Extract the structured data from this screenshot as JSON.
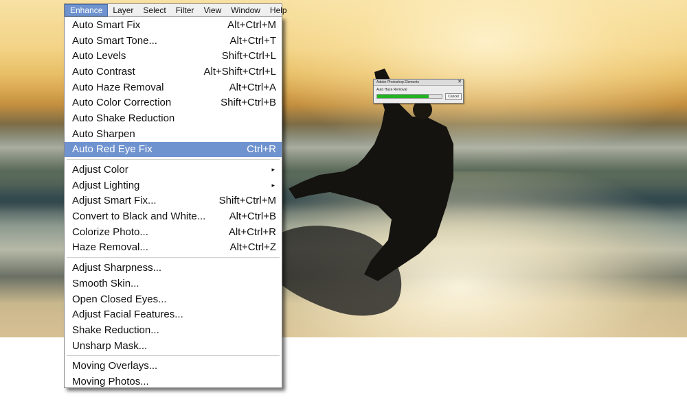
{
  "menubar": {
    "items": [
      "Enhance",
      "Layer",
      "Select",
      "Filter",
      "View",
      "Window",
      "Help"
    ],
    "active": "Enhance"
  },
  "enhance_menu": {
    "group1": [
      {
        "label": "Auto Smart Fix",
        "shortcut": "Alt+Ctrl+M"
      },
      {
        "label": "Auto Smart Tone...",
        "shortcut": "Alt+Ctrl+T"
      },
      {
        "label": "Auto Levels",
        "shortcut": "Shift+Ctrl+L"
      },
      {
        "label": "Auto Contrast",
        "shortcut": "Alt+Shift+Ctrl+L"
      },
      {
        "label": "Auto Haze Removal",
        "shortcut": "Alt+Ctrl+A"
      },
      {
        "label": "Auto Color Correction",
        "shortcut": "Shift+Ctrl+B"
      },
      {
        "label": "Auto Shake Reduction",
        "shortcut": ""
      },
      {
        "label": "Auto Sharpen",
        "shortcut": ""
      },
      {
        "label": "Auto Red Eye Fix",
        "shortcut": "Ctrl+R",
        "highlighted": true
      }
    ],
    "group2": [
      {
        "label": "Adjust Color",
        "submenu": true
      },
      {
        "label": "Adjust Lighting",
        "submenu": true
      },
      {
        "label": "Adjust Smart Fix...",
        "shortcut": "Shift+Ctrl+M"
      },
      {
        "label": "Convert to Black and White...",
        "shortcut": "Alt+Ctrl+B"
      },
      {
        "label": "Colorize Photo...",
        "shortcut": "Alt+Ctrl+R"
      },
      {
        "label": "Haze Removal...",
        "shortcut": "Alt+Ctrl+Z"
      }
    ],
    "group3": [
      {
        "label": "Adjust Sharpness..."
      },
      {
        "label": "Smooth Skin..."
      },
      {
        "label": "Open Closed Eyes..."
      },
      {
        "label": "Adjust Facial Features..."
      },
      {
        "label": "Shake Reduction..."
      },
      {
        "label": "Unsharp Mask..."
      }
    ],
    "group4": [
      {
        "label": "Moving Overlays..."
      },
      {
        "label": "Moving Photos..."
      }
    ]
  },
  "progress_dialog": {
    "title": "Adobe Photoshop Elements",
    "message": "Auto Haze Removal",
    "progress": 0.8,
    "cancel_label": "Cancel",
    "close_glyph": "✕"
  },
  "colors": {
    "highlight": "#6f93cf",
    "progress_fill": "#22b322"
  }
}
